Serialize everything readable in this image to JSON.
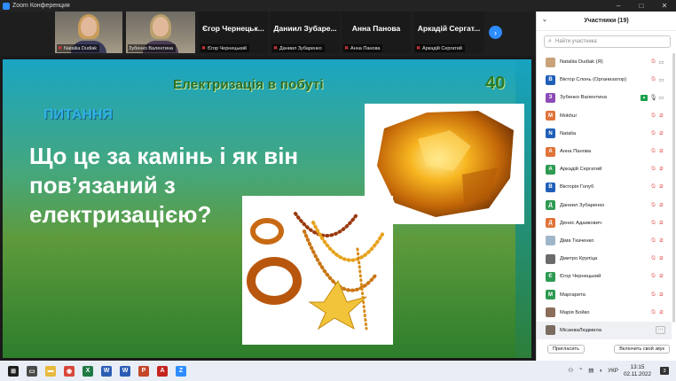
{
  "window": {
    "title": "Zoom Конференция",
    "controls": [
      "–",
      "□",
      "✕"
    ]
  },
  "strip": {
    "tiles": [
      {
        "name": "Nataliia Dudiak",
        "type": "photo"
      },
      {
        "name": "Зубенко Валентина",
        "type": "photo"
      },
      {
        "name": "Єгор Чернецьк...",
        "tag": "Єгор Чернецький",
        "type": "name"
      },
      {
        "name": "Даниил Зубаре...",
        "tag": "Даниил Зубаренко",
        "type": "name"
      },
      {
        "name": "Анна Панова",
        "tag": "Анна Панова",
        "type": "name"
      },
      {
        "name": "Аркадій Сергат...",
        "tag": "Аркадій Сергатий",
        "type": "name"
      }
    ],
    "next_glyph": "›"
  },
  "slide": {
    "title": "Електризація в побуті",
    "number": "40",
    "section": "ПИТАННЯ",
    "question_lines": [
      "Що це за камінь і як він",
      "пов’язаний з",
      "електризацією?"
    ]
  },
  "participants": {
    "header": "Участники (19)",
    "search_placeholder": "Найти участника",
    "list": [
      {
        "name": "Nataliia Dudiak (Я)",
        "avatar": "",
        "avatar_color": "#c9a27a",
        "photo": true,
        "mic": "off",
        "cam": "on"
      },
      {
        "name": "Віктор Слонь (Организатор)",
        "avatar": "В",
        "avatar_color": "#1f5fb8",
        "mic": "off",
        "cam": "on"
      },
      {
        "name": "Зубенко Валентина",
        "avatar": "З",
        "avatar_color": "#8d4bb7",
        "mic": "on",
        "cam": "on",
        "share": true
      },
      {
        "name": "Mokhur",
        "avatar": "M",
        "avatar_color": "#e0733a",
        "mic": "off",
        "cam": "off"
      },
      {
        "name": "Natalia",
        "avatar": "N",
        "avatar_color": "#1f5fb8",
        "mic": "off",
        "cam": "off"
      },
      {
        "name": "Анна Панова",
        "avatar": "А",
        "avatar_color": "#e0733a",
        "mic": "off",
        "cam": "off"
      },
      {
        "name": "Аркадій Сергатий",
        "avatar": "А",
        "avatar_color": "#2e9a52",
        "mic": "off",
        "cam": "off"
      },
      {
        "name": "Вікторія Голуб",
        "avatar": "В",
        "avatar_color": "#1f5fb8",
        "mic": "off",
        "cam": "off"
      },
      {
        "name": "Даниил Зубаренко",
        "avatar": "Д",
        "avatar_color": "#2e9a52",
        "mic": "off",
        "cam": "off"
      },
      {
        "name": "Денис Адаикович",
        "avatar": "Д",
        "avatar_color": "#e0733a",
        "mic": "off",
        "cam": "off"
      },
      {
        "name": "Діма Ткаченко",
        "avatar": "",
        "avatar_color": "#9fb6c9",
        "photo": true,
        "mic": "off",
        "cam": "off"
      },
      {
        "name": "Дмитро Крупіца",
        "avatar": "",
        "avatar_color": "#6b6b6b",
        "photo": true,
        "mic": "off",
        "cam": "off"
      },
      {
        "name": "Єгор Чернецький",
        "avatar": "Є",
        "avatar_color": "#2e9a52",
        "mic": "off",
        "cam": "off"
      },
      {
        "name": "Маргарита",
        "avatar": "М",
        "avatar_color": "#2e9a52",
        "mic": "off",
        "cam": "off"
      },
      {
        "name": "Марія Бойко",
        "avatar": "",
        "avatar_color": "#8c6e5a",
        "photo": true,
        "mic": "off",
        "cam": "off"
      },
      {
        "name": "МісаеваЛюдмила",
        "avatar": "",
        "avatar_color": "#7a6d60",
        "photo": true,
        "more": true,
        "selected": true
      }
    ],
    "invite_button": "Пригласить",
    "unmute_button": "Включить свой звук"
  },
  "taskbar": {
    "apps": [
      {
        "icon": "windows-start-icon",
        "color": "#1e1e1e",
        "glyph": "⊞"
      },
      {
        "icon": "task-view-icon",
        "color": "#4a4a4a",
        "glyph": "▭"
      },
      {
        "icon": "file-explorer-icon",
        "color": "#e8b93a",
        "glyph": "▬"
      },
      {
        "icon": "chrome-icon",
        "color": "#d9463b",
        "glyph": "◉"
      },
      {
        "icon": "excel-icon",
        "color": "#1f7a44",
        "glyph": "X"
      },
      {
        "icon": "word-icon",
        "color": "#2b5db5",
        "glyph": "W"
      },
      {
        "icon": "word-icon-2",
        "color": "#2b5db5",
        "glyph": "W"
      },
      {
        "icon": "powerpoint-icon",
        "color": "#c4472a",
        "glyph": "P"
      },
      {
        "icon": "acrobat-icon",
        "color": "#c52420",
        "glyph": "A"
      },
      {
        "icon": "zoom-icon",
        "color": "#2d8cff",
        "glyph": "Z"
      }
    ],
    "language": "УКР",
    "time": "13:15",
    "date": "02.11.2022",
    "notifications": "3"
  }
}
